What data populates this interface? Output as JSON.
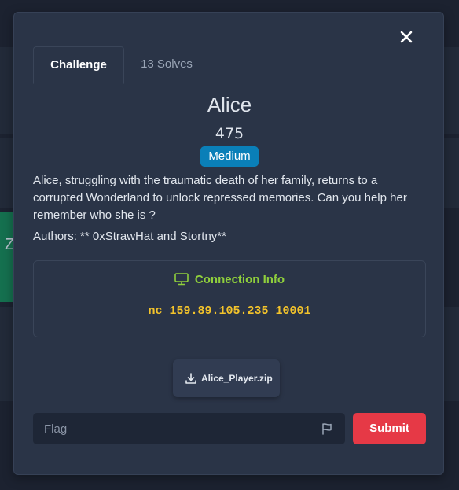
{
  "modal": {
    "close_icon": "close-icon",
    "tabs": [
      {
        "label": "Challenge",
        "active": true
      },
      {
        "label": "13 Solves",
        "active": false
      }
    ],
    "challenge": {
      "title": "Alice",
      "points": "475",
      "difficulty": "Medium",
      "description": "Alice, struggling with the traumatic death of her family, returns to a corrupted Wonderland to unlock repressed memories. Can you help her remember who she is ?",
      "authors": "Authors: ** 0xStrawHat and Stortny**"
    },
    "connection": {
      "heading": "Connection Info",
      "icon": "monitor-icon",
      "command": "nc 159.89.105.235 10001"
    },
    "file": {
      "label": "Alice_Player.zip",
      "icon": "download-icon"
    },
    "flag_form": {
      "placeholder": "Flag",
      "value": "",
      "icon": "flag-icon",
      "submit_label": "Submit"
    }
  },
  "background": {
    "partial_letter": "Z"
  },
  "colors": {
    "modal_bg": "#2a3447",
    "badge": "#0a7fb8",
    "connection_heading": "#8fcf3c",
    "command": "#f3c32b",
    "submit": "#e63946"
  }
}
